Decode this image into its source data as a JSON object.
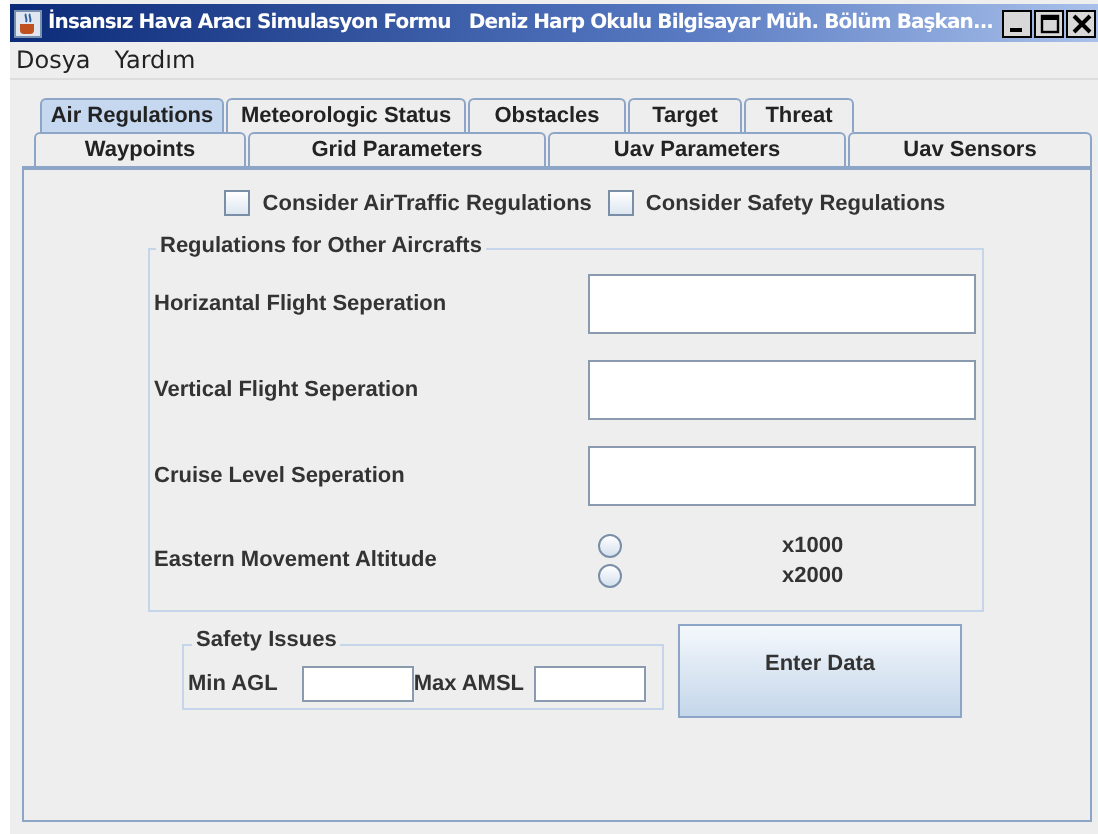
{
  "window": {
    "title": "İnsansız Hava Aracı Simulasyon Formu   Deniz Harp Okulu Bilgisayar Müh. Bölüm Başkan..."
  },
  "menu": [
    "Dosya",
    "Yardım"
  ],
  "tab_rows": [
    [
      {
        "label": "Air Regulations",
        "selected": true
      },
      {
        "label": "Meteorologic Status",
        "selected": false
      },
      {
        "label": "Obstacles",
        "selected": false
      },
      {
        "label": "Target",
        "selected": false
      },
      {
        "label": "Threat",
        "selected": false
      }
    ],
    [
      {
        "label": "Waypoints",
        "selected": false
      },
      {
        "label": "Grid Parameters",
        "selected": false
      },
      {
        "label": "Uav Parameters",
        "selected": false
      },
      {
        "label": "Uav Sensors",
        "selected": false
      }
    ]
  ],
  "checkboxes": [
    {
      "label": "Consider AirTraffic Regulations",
      "checked": false
    },
    {
      "label": "Consider Safety Regulations",
      "checked": false
    }
  ],
  "regulations": {
    "title": "Regulations for Other Aircrafts",
    "fields": [
      {
        "label": "Horizantal Flight Seperation"
      },
      {
        "label": "Vertical Flight Seperation"
      },
      {
        "label": "Cruise Level Seperation"
      }
    ],
    "altitude": {
      "label": "Eastern Movement Altitude",
      "options": [
        {
          "label": "x1000",
          "selected": false
        },
        {
          "label": "x2000",
          "selected": false
        }
      ]
    }
  },
  "safety": {
    "title": "Safety Issues",
    "fields": [
      {
        "label": "Min AGL"
      },
      {
        "label": "Max AMSL"
      }
    ]
  },
  "button": "Enter Data"
}
